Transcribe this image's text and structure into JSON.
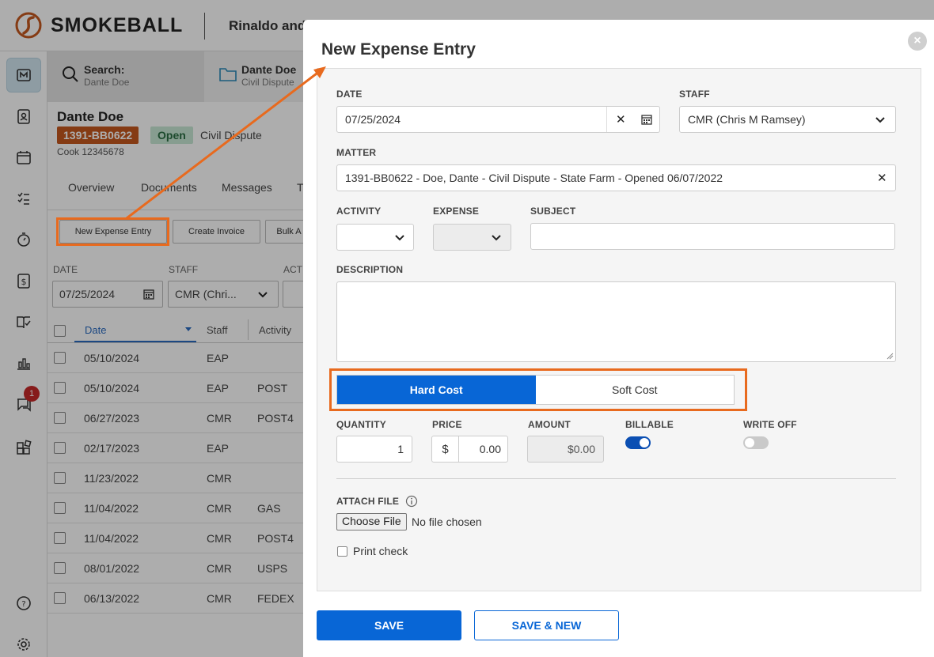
{
  "app": {
    "brand": "SMOKEBALL",
    "firm_name": "Rinaldo and",
    "accent_color": "#0866d6",
    "highlight_color": "#e86a1e"
  },
  "sidebar": {
    "icons": [
      "matter-icon",
      "contacts-icon",
      "calendar-icon",
      "tasks-icon",
      "timer-icon",
      "billing-icon",
      "library-icon",
      "reports-icon",
      "messages-icon",
      "apps-icon",
      "help-icon",
      "settings-icon"
    ],
    "messages_badge": "1"
  },
  "tabs": {
    "search_title": "Search:",
    "search_sub": "Dante Doe",
    "matter_title": "Dante Doe",
    "matter_sub": "Civil Dispute"
  },
  "matter_header": {
    "client_name": "Dante Doe",
    "matter_number": "1391-BB0622",
    "status": "Open",
    "matter_type": "Civil Dispute",
    "reference": "Cook 12345678"
  },
  "nav": {
    "items": [
      "Overview",
      "Documents",
      "Messages",
      "T"
    ]
  },
  "actions": {
    "new_expense": "New Expense Entry",
    "create_invoice": "Create Invoice",
    "bulk": "Bulk A"
  },
  "filters": {
    "date_label": "DATE",
    "date_value": "07/25/2024",
    "staff_label": "STAFF",
    "staff_value": "CMR (Chri...",
    "activity_label": "ACT"
  },
  "grid": {
    "headers": [
      "Date",
      "Staff",
      "Activity"
    ],
    "rows": [
      {
        "date": "05/10/2024",
        "staff": "EAP",
        "activity": ""
      },
      {
        "date": "05/10/2024",
        "staff": "EAP",
        "activity": "POST"
      },
      {
        "date": "06/27/2023",
        "staff": "CMR",
        "activity": "POST4"
      },
      {
        "date": "02/17/2023",
        "staff": "EAP",
        "activity": ""
      },
      {
        "date": "11/23/2022",
        "staff": "CMR",
        "activity": ""
      },
      {
        "date": "11/04/2022",
        "staff": "CMR",
        "activity": "GAS"
      },
      {
        "date": "11/04/2022",
        "staff": "CMR",
        "activity": "POST4"
      },
      {
        "date": "08/01/2022",
        "staff": "CMR",
        "activity": "USPS"
      },
      {
        "date": "06/13/2022",
        "staff": "CMR",
        "activity": "FEDEX"
      }
    ]
  },
  "modal": {
    "title": "New Expense Entry",
    "date_label": "DATE",
    "date_value": "07/25/2024",
    "staff_label": "STAFF",
    "staff_value": "CMR (Chris M Ramsey)",
    "matter_label": "MATTER",
    "matter_value": "1391-BB0622 - Doe, Dante - Civil Dispute - State Farm - Opened 06/07/2022",
    "activity_label": "ACTIVITY",
    "expense_label": "EXPENSE",
    "subject_label": "SUBJECT",
    "subject_value": "",
    "description_label": "DESCRIPTION",
    "description_value": "",
    "cost_options": [
      "Hard Cost",
      "Soft Cost"
    ],
    "cost_selected": "Hard Cost",
    "quantity_label": "QUANTITY",
    "quantity_value": "1",
    "price_label": "PRICE",
    "currency": "$",
    "price_value": "0.00",
    "amount_label": "AMOUNT",
    "amount_value": "$0.00",
    "billable_label": "BILLABLE",
    "billable_on": true,
    "writeoff_label": "WRITE OFF",
    "writeoff_on": false,
    "attach_label": "ATTACH FILE",
    "choose_file": "Choose File",
    "no_file": "No file chosen",
    "print_check": "Print check",
    "save": "SAVE",
    "save_new": "SAVE & NEW"
  }
}
